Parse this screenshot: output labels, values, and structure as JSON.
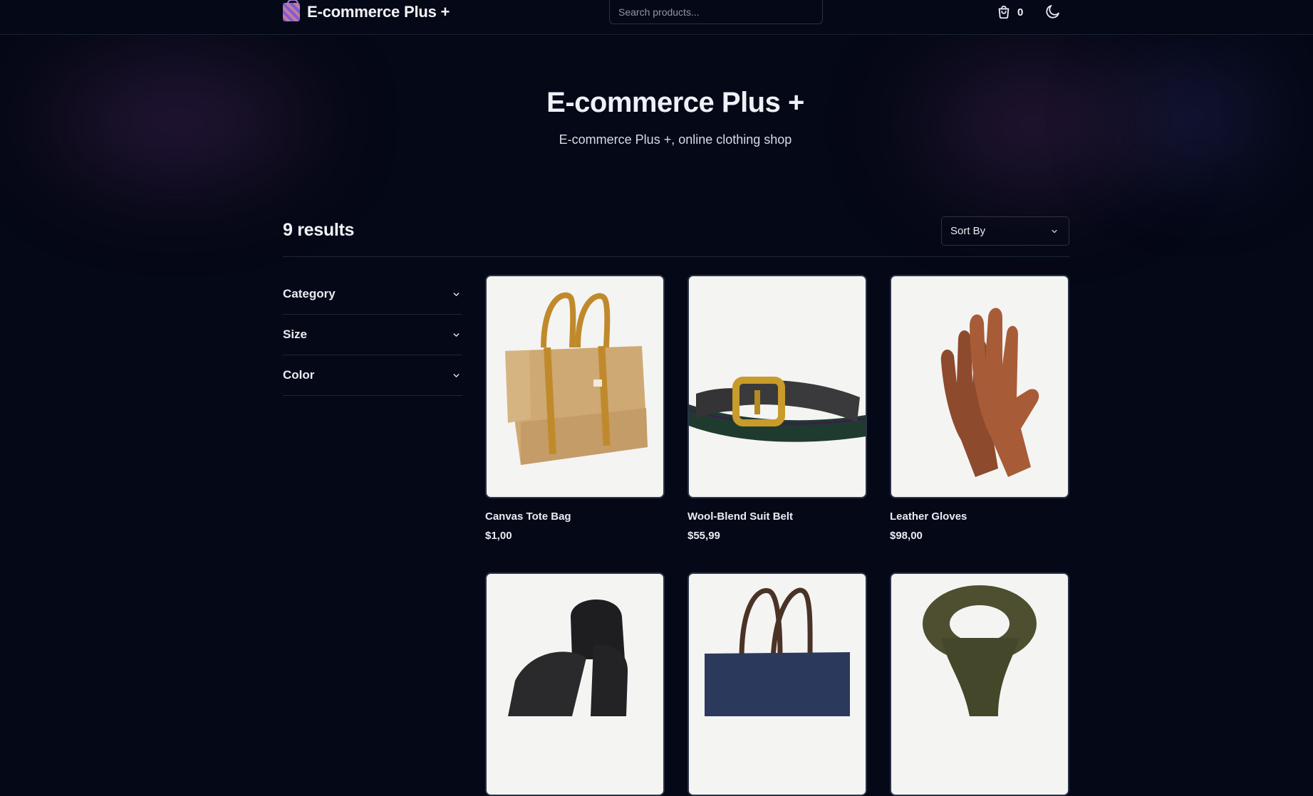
{
  "header": {
    "brand_title": "E-commerce Plus +",
    "search_placeholder": "Search products...",
    "cart_count": "0"
  },
  "hero": {
    "title": "E-commerce Plus +",
    "subtitle": "E-commerce Plus +, online clothing shop"
  },
  "results": {
    "count_label": "9 results",
    "sort_label": "Sort By"
  },
  "filters": [
    {
      "label": "Category"
    },
    {
      "label": "Size"
    },
    {
      "label": "Color"
    }
  ],
  "products": [
    {
      "name": "Canvas Tote Bag",
      "price": "$1,00",
      "image": "canvas-tote-bag"
    },
    {
      "name": "Wool-Blend Suit Belt",
      "price": "$55,99",
      "image": "suit-belt"
    },
    {
      "name": "Leather Gloves",
      "price": "$98,00",
      "image": "leather-gloves"
    },
    {
      "name": "",
      "price": "",
      "image": "black-beanie"
    },
    {
      "name": "",
      "price": "",
      "image": "navy-tote-bag"
    },
    {
      "name": "",
      "price": "",
      "image": "olive-scarf"
    }
  ],
  "icons": {
    "logo": "shopping-bag-logo-icon",
    "cart": "cart-bag-icon",
    "theme": "moon-icon",
    "chevron": "chevron-down-icon"
  },
  "colors": {
    "background": "#050816",
    "border": "#2a3142",
    "text": "#e9ecf3",
    "card_background": "#f4f4f3"
  }
}
